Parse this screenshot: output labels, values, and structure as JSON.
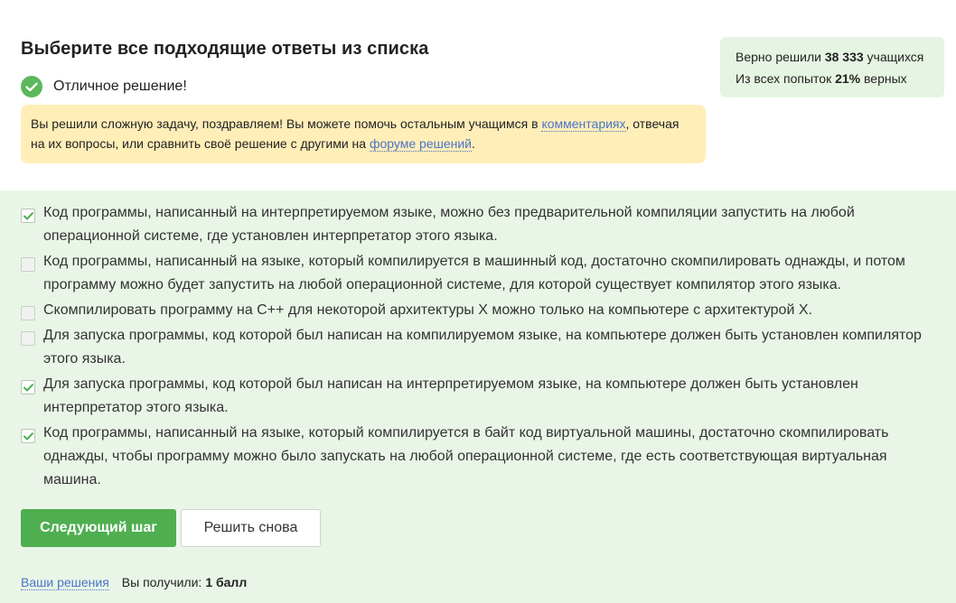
{
  "title": "Выберите все подходящие ответы из списка",
  "success": {
    "text": "Отличное решение!"
  },
  "notice": {
    "part1": "Вы решили сложную задачу, поздравляем! Вы можете помочь остальным учащимся в ",
    "link1": "комментариях",
    "part2": ", отвечая на их вопросы, или сравнить своё решение с другими на ",
    "link2": "форуме решений",
    "part3": "."
  },
  "stats": {
    "solved_prefix": "Верно решили ",
    "solved_count": "38 333",
    "solved_suffix": " учащихся",
    "attempts_prefix": "Из всех попыток ",
    "attempts_pct": "21%",
    "attempts_suffix": " верных"
  },
  "options": [
    {
      "text": "Код программы, написанный на интерпретируемом языке, можно без предварительной компиляции запустить на любой операционной системе, где установлен интерпретатор этого языка.",
      "checked": true
    },
    {
      "text": "Код программы, написанный на языке, который компилируется в машинный код, достаточно скомпилировать однажды, и потом программу можно будет запустить на любой операционной системе, для которой существует компилятор этого языка.",
      "checked": false
    },
    {
      "text": "Скомпилировать программу на C++ для некоторой архитектуры X можно только на компьютере с архитектурой X.",
      "checked": false
    },
    {
      "text": "Для запуска программы, код которой был написан на компилируемом языке, на компьютере должен быть установлен компилятор этого языка.",
      "checked": false
    },
    {
      "text": "Для запуска программы, код которой был написан на интерпретируемом языке, на компьютере должен быть установлен интерпретатор этого языка.",
      "checked": true
    },
    {
      "text": "Код программы, написанный на языке, который компилируется в байт код виртуальной машины, достаточно скомпилировать однажды, чтобы программу можно было запускать на любой операционной системе, где есть соответствующая виртуальная машина.",
      "checked": true
    }
  ],
  "buttons": {
    "next": "Следующий шаг",
    "retry": "Решить снова"
  },
  "footer": {
    "solutions_link": "Ваши решения",
    "score_label": "Вы получили:",
    "score_value": "1 балл"
  },
  "colors": {
    "accent": "#4fae50",
    "answer_bg": "#e9f6e7",
    "notice_bg": "#ffeeb8",
    "link": "#4b74c6"
  }
}
